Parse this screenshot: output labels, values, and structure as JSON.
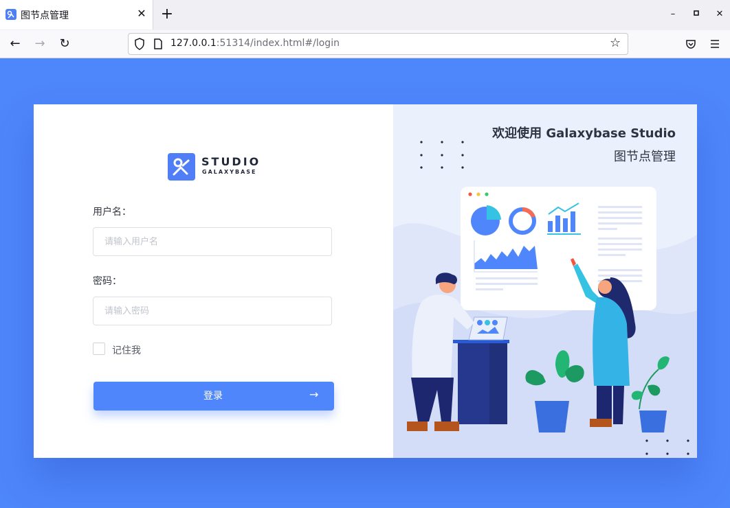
{
  "browser": {
    "tab_title": "图节点管理",
    "tab_close": "✕",
    "new_tab": "+",
    "url_host": "127.0.0.1",
    "url_rest": ":51314/index.html#/login",
    "nav": {
      "back": "←",
      "forward": "→",
      "reload": "↻"
    },
    "window": {
      "minimize": "–",
      "maximize": "▫",
      "close": "✕"
    },
    "icons": {
      "shield": "shield-icon",
      "page": "page-icon",
      "star": "star-icon",
      "pocket": "pocket-icon",
      "menu": "hamburger-menu-icon"
    }
  },
  "login": {
    "logo": {
      "main": "STUDIO",
      "sub": "GALAXYBASE"
    },
    "username_label": "用户名：",
    "username_placeholder": "请输入用户名",
    "password_label": "密码：",
    "password_placeholder": "请输入密码",
    "remember_label": "记住我",
    "remember_checked": false,
    "submit_label": "登录",
    "submit_arrow": "→"
  },
  "hero": {
    "welcome_line1": "欢迎使用 Galaxybase Studio",
    "welcome_line2": "图节点管理"
  },
  "colors": {
    "accent": "#4f86fb",
    "page_bg": "#4e86fb",
    "hero_bg": "#ebf0fd"
  }
}
